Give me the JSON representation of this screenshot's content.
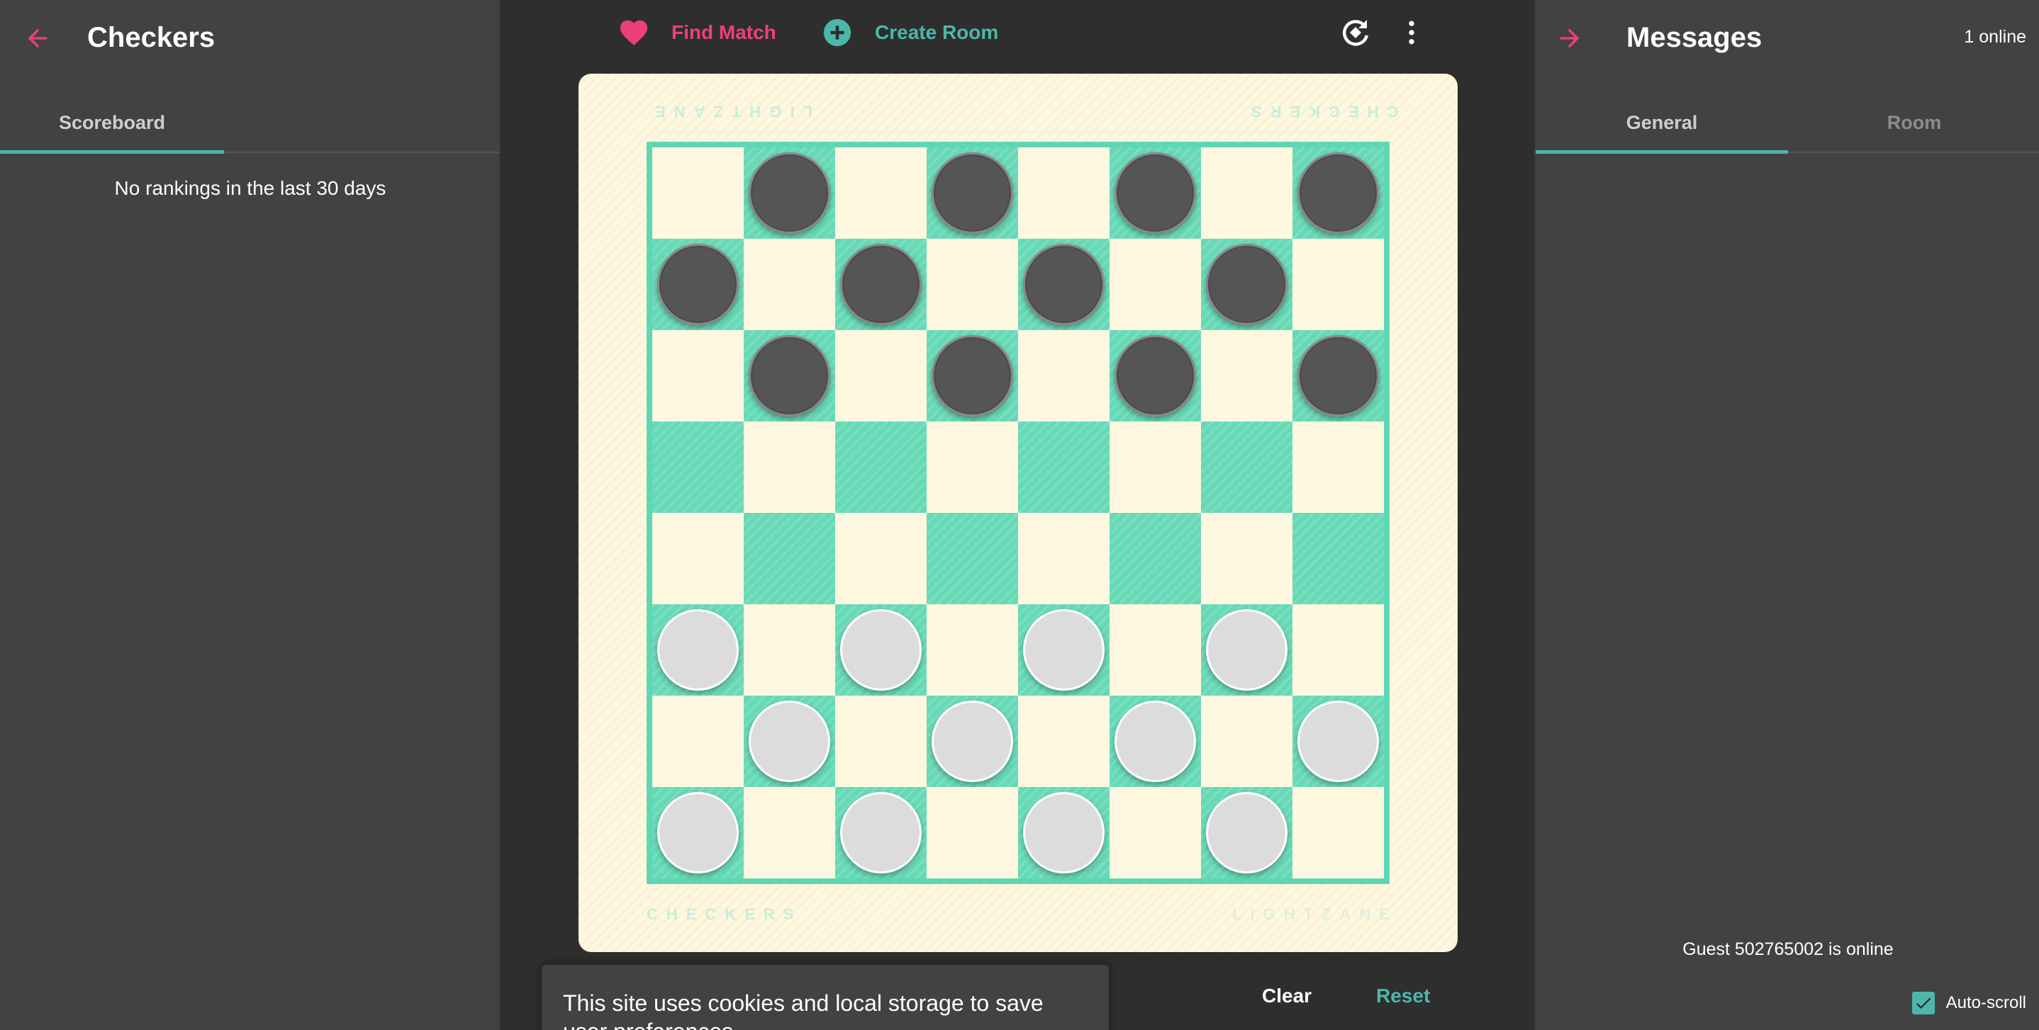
{
  "left_panel": {
    "title": "Checkers",
    "tabs": [
      {
        "label": "Scoreboard",
        "active": true
      }
    ],
    "empty_message": "No rankings in the last 30 days"
  },
  "toolbar": {
    "find_match_label": "Find Match",
    "create_room_label": "Create Room",
    "icons": [
      "heart-icon",
      "add-circle-icon",
      "rotate-icon",
      "more-vert-icon"
    ]
  },
  "board": {
    "corner_labels": {
      "top_left": "LIGHTZANE",
      "top_right": "CHECKERS",
      "bottom_left": "CHECKERS",
      "bottom_right": "LIGHTZANE"
    },
    "rows": [
      ". D . D . D . D",
      "D . D . D . D .",
      ". D . D . D . D",
      ". . . . . . . .",
      ". . . . . . . .",
      "L . L . L . L .",
      ". L . L . L . L",
      "L . L . L . L ."
    ],
    "legend": {
      "D": "dark piece",
      "L": "light piece",
      ".": "empty"
    }
  },
  "controls": {
    "clear_label": "Clear",
    "reset_label": "Reset"
  },
  "cookie_banner": {
    "text": "This site uses cookies and local storage to save user preferences"
  },
  "right_panel": {
    "title": "Messages",
    "online_count": "1 online",
    "tabs": [
      {
        "label": "General",
        "active": true
      },
      {
        "label": "Room",
        "active": false
      }
    ],
    "messages": [
      "Guest 502765002 is online"
    ],
    "autoscroll_label": "Auto-scroll",
    "autoscroll_checked": true
  },
  "colors": {
    "accent_pink": "#ec407a",
    "accent_teal": "#4db6ac",
    "board_dark": "#66d9b6",
    "board_light": "#fff8e1",
    "panel_bg": "#424242",
    "page_bg": "#2e2e2e"
  }
}
